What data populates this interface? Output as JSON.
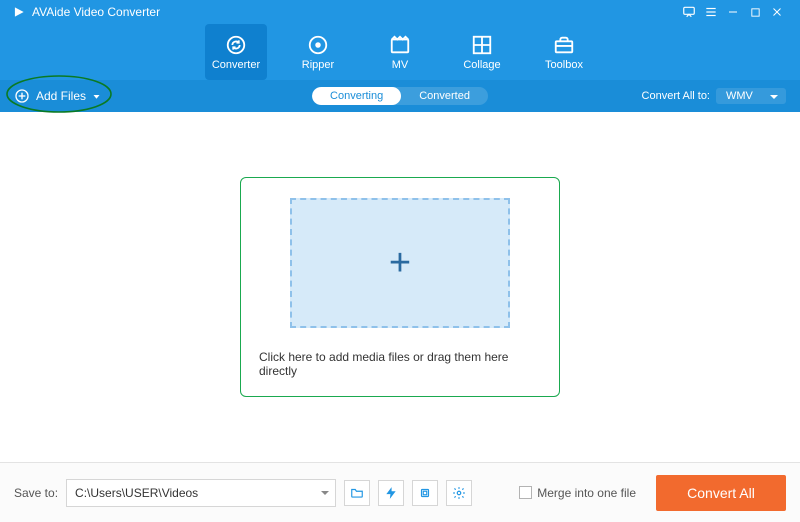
{
  "title": "AVAide Video Converter",
  "nav": {
    "converter": "Converter",
    "ripper": "Ripper",
    "mv": "MV",
    "collage": "Collage",
    "toolbox": "Toolbox"
  },
  "subbar": {
    "add_files": "Add Files",
    "tab_converting": "Converting",
    "tab_converted": "Converted",
    "convert_all_to": "Convert All to:",
    "format_selected": "WMV"
  },
  "stage": {
    "hint": "Click here to add media files or drag them here directly"
  },
  "footer": {
    "save_to": "Save to:",
    "path": "C:\\Users\\USER\\Videos",
    "merge": "Merge into one file",
    "convert_all": "Convert All"
  }
}
